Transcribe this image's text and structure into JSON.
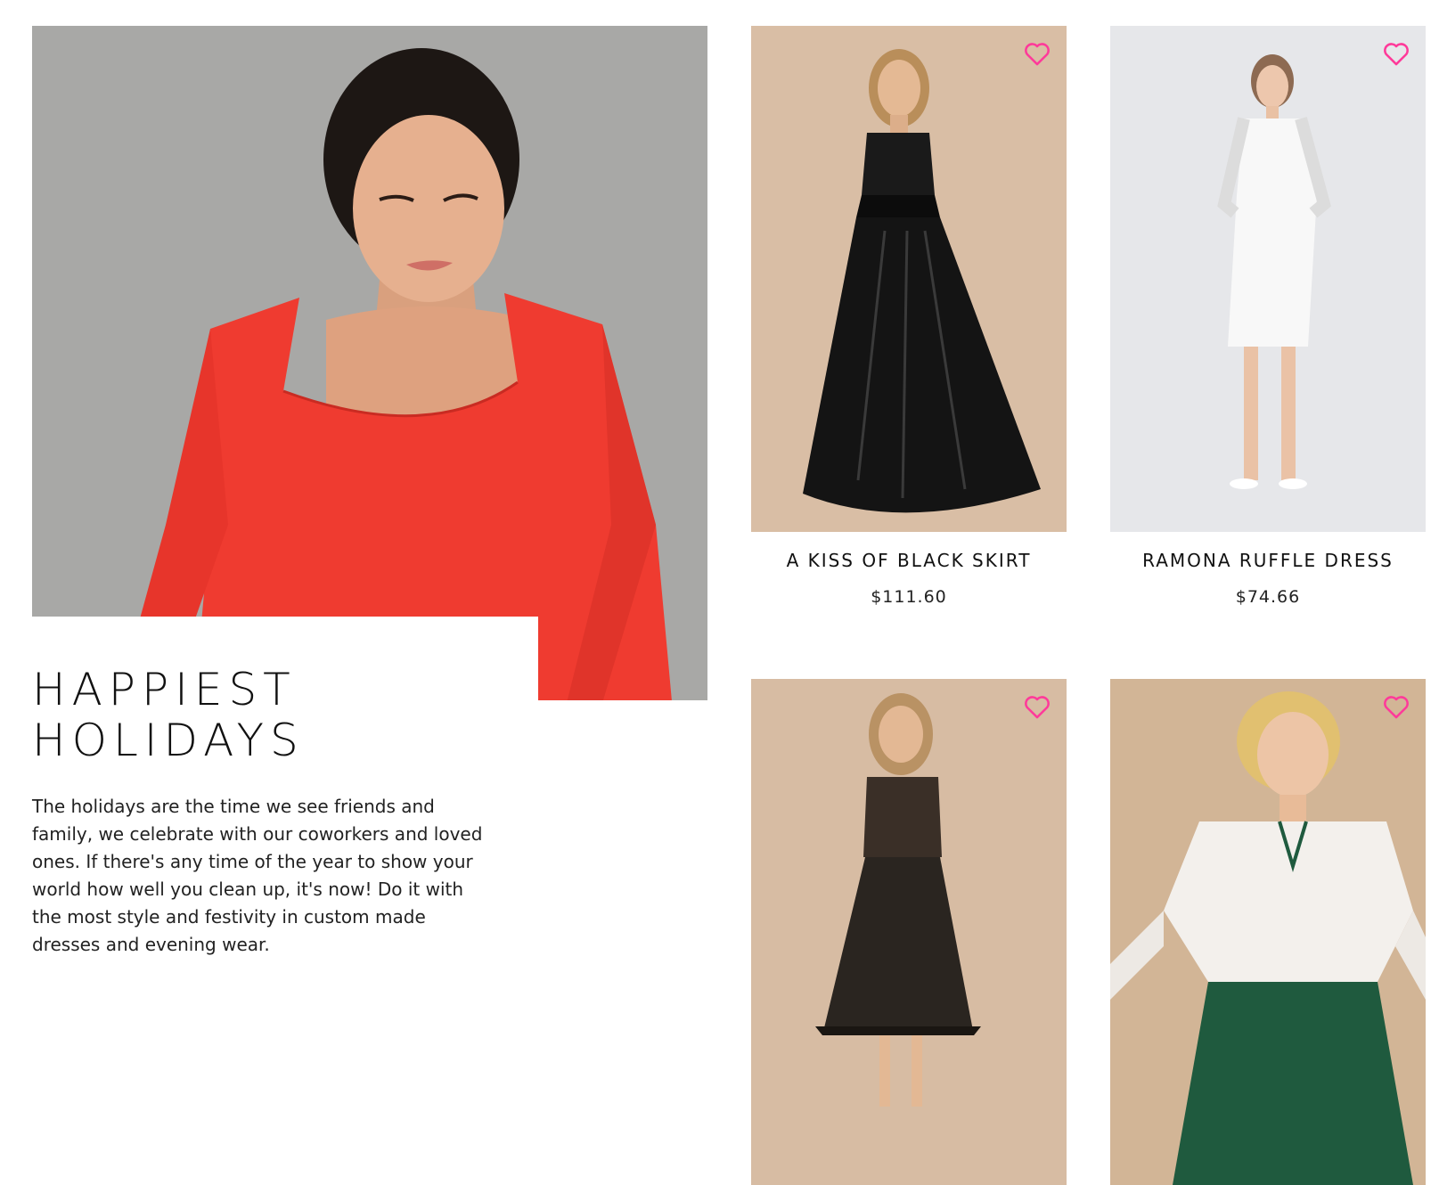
{
  "promo": {
    "title_line1": "HAPPIEST",
    "title_line2": "HOLIDAYS",
    "body": "The holidays are the time we see friends and family, we celebrate with our coworkers and loved ones. If there's any time of the year to show your world how well you clean up, it's now! Do it with the most style and festivity in custom made dresses and evening wear."
  },
  "products": [
    {
      "name": "A KISS OF BLACK SKIRT",
      "price": "$111.60",
      "photo_bg": "#d9bea5",
      "garment_color": "#111111"
    },
    {
      "name": "RAMONA RUFFLE DRESS",
      "price": "$74.66",
      "photo_bg": "#e6e7ea",
      "garment_color": "#f7f7f7"
    },
    {
      "name": "",
      "price": "",
      "photo_bg": "#d7bca3",
      "garment_color": "#2a2520"
    },
    {
      "name": "",
      "price": "",
      "photo_bg": "#d2b596",
      "garment_color": "#1f5a3e"
    }
  ],
  "colors": {
    "wishlist_heart": "#ff3a9a",
    "hero_background": "#a8a8a6",
    "hero_dress": "#ef3b30"
  },
  "icons": {
    "wishlist": "heart-outline-icon"
  }
}
